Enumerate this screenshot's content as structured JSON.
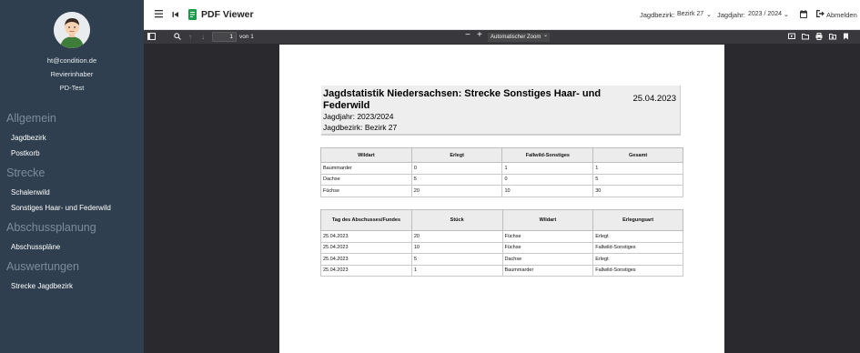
{
  "sidebar": {
    "email": "ht@condition.de",
    "role": "Revierinhaber",
    "org": "PD-Test",
    "sections": [
      {
        "label": "Allgemein",
        "items": [
          {
            "label": "Jagdbezirk"
          },
          {
            "label": "Postkorb"
          }
        ]
      },
      {
        "label": "Strecke",
        "items": [
          {
            "label": "Schalenwild"
          },
          {
            "label": "Sonstiges Haar- und Federwild"
          }
        ]
      },
      {
        "label": "Abschussplanung",
        "items": [
          {
            "label": "Abschusspläne"
          }
        ]
      },
      {
        "label": "Auswertungen",
        "items": [
          {
            "label": "Strecke Jagdbezirk"
          }
        ]
      }
    ]
  },
  "topbar": {
    "menu_icon": "hamburger-icon",
    "back_icon": "skip-back-icon",
    "app_icon": "document-icon",
    "app_title": "PDF Viewer",
    "jagdbezirk_label": "Jagdbezirk:",
    "jagdbezirk_value": "Bezirk 27",
    "jagdjahr_label": "Jagdjahr:",
    "jagdjahr_value": "2023 / 2024",
    "logout_label": "Abmelden",
    "accent": "#1b9c4a"
  },
  "pdf_toolbar": {
    "page_number": "1",
    "page_of": "von 1",
    "zoom_label": "Automatischer Zoom"
  },
  "document": {
    "title": "Jagdstatistik Niedersachsen: Strecke Sonstiges Haar- und Federwild",
    "date": "25.04.2023",
    "jagdjahr": "Jagdjahr: 2023/2024",
    "jagdbezirk": "Jagdbezirk: Bezirk 27",
    "summary_table": {
      "headers": [
        "Wildart",
        "Erlegt",
        "Fallwild-Sonstiges",
        "Gesamt"
      ],
      "rows": [
        [
          "Baummarder",
          "0",
          "1",
          "1"
        ],
        [
          "Dachse",
          "5",
          "0",
          "5"
        ],
        [
          "Füchse",
          "20",
          "10",
          "30"
        ]
      ]
    },
    "detail_table": {
      "headers": [
        "Tag des Abschusses/Fundes",
        "Stück",
        "Wildart",
        "Erlegungsart"
      ],
      "rows": [
        [
          "25.04.2023",
          "20",
          "Füchse",
          "Erlegt"
        ],
        [
          "25.04.2023",
          "10",
          "Füchse",
          "Fallwild-Sonstiges"
        ],
        [
          "25.04.2023",
          "5",
          "Dachse",
          "Erlegt"
        ],
        [
          "25.04.2023",
          "1",
          "Baummarder",
          "Fallwild-Sonstiges"
        ]
      ]
    }
  }
}
